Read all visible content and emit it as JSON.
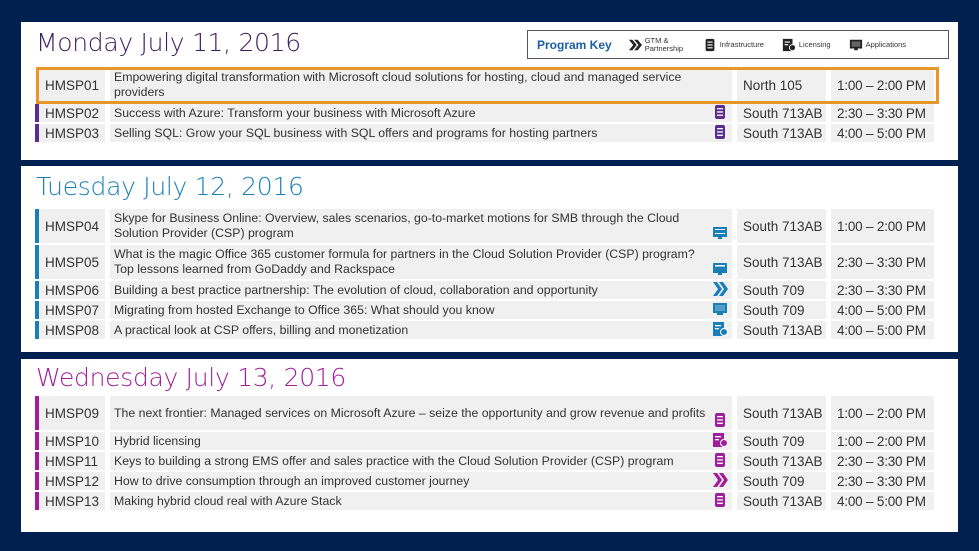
{
  "program_key": {
    "label": "Program Key",
    "items": [
      {
        "icon": "gtm-partnership-icon",
        "label": "GTM & Partnership"
      },
      {
        "icon": "infrastructure-icon",
        "label": "Infrastructure"
      },
      {
        "icon": "licensing-icon",
        "label": "Licensing"
      },
      {
        "icon": "applications-icon",
        "label": "Applications"
      }
    ]
  },
  "colors": {
    "background": "#00204f",
    "monday": "#5c2d91",
    "tuesday": "#1a7fb8",
    "wednesday": "#a01e9a",
    "highlight": "#e8962a",
    "key_label": "#1a5fa8"
  },
  "days": [
    {
      "title": "Monday July 11, 2016",
      "sessions": [
        {
          "code": "HMSP01",
          "title": "Empowering digital transformation with Microsoft cloud solutions for hosting, cloud and managed service providers",
          "track": "",
          "room": "North 105",
          "time": "1:00 – 2:00 PM",
          "highlighted": true
        },
        {
          "code": "HMSP02",
          "title": "Success with Azure: Transform your business with Microsoft Azure",
          "track": "infrastructure",
          "room": "South 713AB",
          "time": "2:30 – 3:30 PM"
        },
        {
          "code": "HMSP03",
          "title": "Selling SQL: Grow your SQL business with SQL offers and programs for hosting partners",
          "track": "infrastructure",
          "room": "South 713AB",
          "time": "4:00 – 5:00 PM"
        }
      ]
    },
    {
      "title": "Tuesday July 12, 2016",
      "sessions": [
        {
          "code": "HMSP04",
          "title": "Skype for Business Online: Overview, sales scenarios, go-to-market motions for SMB through the Cloud Solution Provider (CSP) program",
          "track": "applications",
          "room": "South 713AB",
          "time": "1:00 – 2:00 PM"
        },
        {
          "code": "HMSP05",
          "title": "What is the magic Office 365 customer formula for partners in the Cloud Solution Provider (CSP) program? Top lessons learned from GoDaddy and Rackspace",
          "track": "applications",
          "room": "South 713AB",
          "time": "2:30 – 3:30 PM"
        },
        {
          "code": "HMSP06",
          "title": "Building a best practice partnership: The evolution of cloud, collaboration and opportunity",
          "track": "gtm",
          "room": "South 709",
          "time": "2:30 – 3:30 PM"
        },
        {
          "code": "HMSP07",
          "title": "Migrating from hosted Exchange to Office 365: What should you know",
          "track": "applications",
          "room": "South 709",
          "time": "4:00 – 5:00 PM"
        },
        {
          "code": "HMSP08",
          "title": "A practical look at CSP offers, billing and monetization",
          "track": "licensing",
          "room": "South 713AB",
          "time": "4:00 – 5:00 PM"
        }
      ]
    },
    {
      "title": "Wednesday July 13, 2016",
      "sessions": [
        {
          "code": "HMSP09",
          "title": "The next frontier: Managed services on Microsoft Azure – seize the opportunity and grow revenue and profits",
          "track": "infrastructure",
          "room": "South 713AB",
          "time": "1:00 – 2:00 PM"
        },
        {
          "code": "HMSP10",
          "title": "Hybrid licensing",
          "track": "licensing",
          "room": "South 709",
          "time": "1:00 – 2:00 PM"
        },
        {
          "code": "HMSP11",
          "title": "Keys to building a strong EMS offer and sales practice with the Cloud Solution Provider (CSP) program",
          "track": "infrastructure",
          "room": "South 713AB",
          "time": "2:30 – 3:30 PM"
        },
        {
          "code": "HMSP12",
          "title": "How to drive consumption through an improved customer journey",
          "track": "gtm",
          "room": "South 709",
          "time": "2:30 – 3:30 PM"
        },
        {
          "code": "HMSP13",
          "title": "Making hybrid cloud real with Azure Stack",
          "track": "infrastructure",
          "room": "South 713AB",
          "time": "4:00 – 5:00 PM"
        }
      ]
    }
  ]
}
